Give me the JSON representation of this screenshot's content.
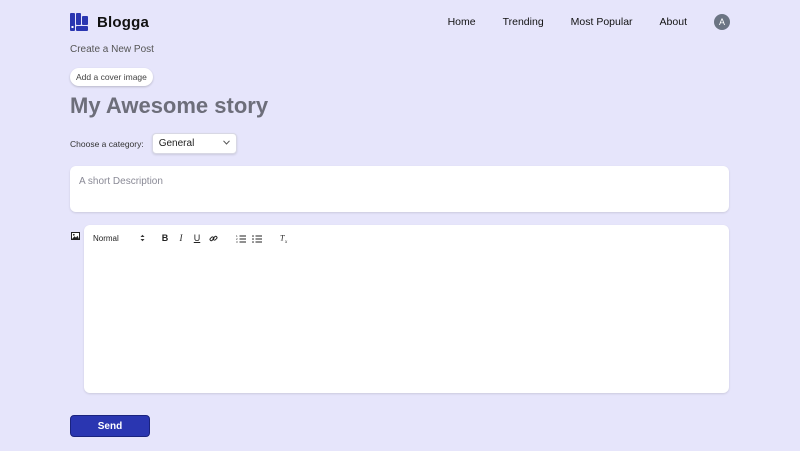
{
  "nav": {
    "brand": "Blogga",
    "links": [
      "Home",
      "Trending",
      "Most Popular",
      "About"
    ],
    "avatar_letter": "A"
  },
  "form": {
    "heading": "Create a New Post",
    "cover_button": "Add a cover image",
    "title": "My Awesome story",
    "category_label": "Choose a category:",
    "category_value": "General",
    "description_placeholder": "A short Description",
    "editor": {
      "heading_select": "Normal",
      "bold": "B",
      "italic": "I",
      "underline": "U",
      "clear_format": "Tx"
    },
    "send_button": "Send"
  },
  "colors": {
    "page_bg": "#e6e5fb",
    "brand_blue": "#2a36b1",
    "title_gray": "#6d6e7a",
    "avatar_bg": "#6b7483"
  },
  "icons": [
    "blogga-logo-icon",
    "image-icon",
    "link-icon",
    "ordered-list-icon",
    "bullet-list-icon",
    "clear-format-icon",
    "chevron-down-icon"
  ]
}
